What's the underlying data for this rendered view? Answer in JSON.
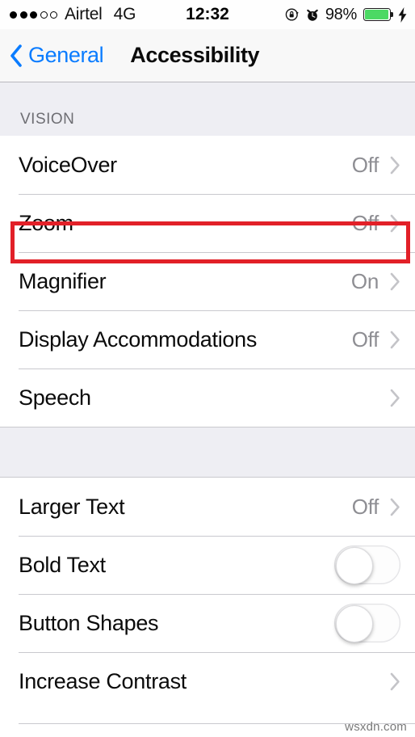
{
  "status_bar": {
    "signal_dots_filled": 3,
    "signal_dots_total": 5,
    "carrier": "Airtel",
    "network": "4G",
    "time": "12:32",
    "rotation_lock_icon": "rotation-lock-icon",
    "alarm_icon": "alarm-clock-icon",
    "battery_percent": "98%",
    "battery_level": 98,
    "battery_color": "#4cd964",
    "charging_icon": "lightning-bolt-icon"
  },
  "navbar": {
    "back_icon": "chevron-left-icon",
    "back_label": "General",
    "title": "Accessibility",
    "accent_color": "#0a7cff"
  },
  "sections": [
    {
      "header": "VISION",
      "rows": [
        {
          "label": "VoiceOver",
          "value": "Off",
          "control": "chevron"
        },
        {
          "label": "Zoom",
          "value": "Off",
          "control": "chevron",
          "highlighted": true
        },
        {
          "label": "Magnifier",
          "value": "On",
          "control": "chevron"
        },
        {
          "label": "Display Accommodations",
          "value": "Off",
          "control": "chevron"
        },
        {
          "label": "Speech",
          "value": "",
          "control": "chevron"
        }
      ]
    },
    {
      "header": "",
      "rows": [
        {
          "label": "Larger Text",
          "value": "Off",
          "control": "chevron"
        },
        {
          "label": "Bold Text",
          "value": "",
          "control": "toggle",
          "toggle_on": false
        },
        {
          "label": "Button Shapes",
          "value": "",
          "control": "toggle",
          "toggle_on": false
        },
        {
          "label": "Increase Contrast",
          "value": "",
          "control": "chevron"
        }
      ]
    }
  ],
  "highlight": {
    "target": "Zoom",
    "color": "#e22028"
  },
  "watermark": "wsxdn.com"
}
